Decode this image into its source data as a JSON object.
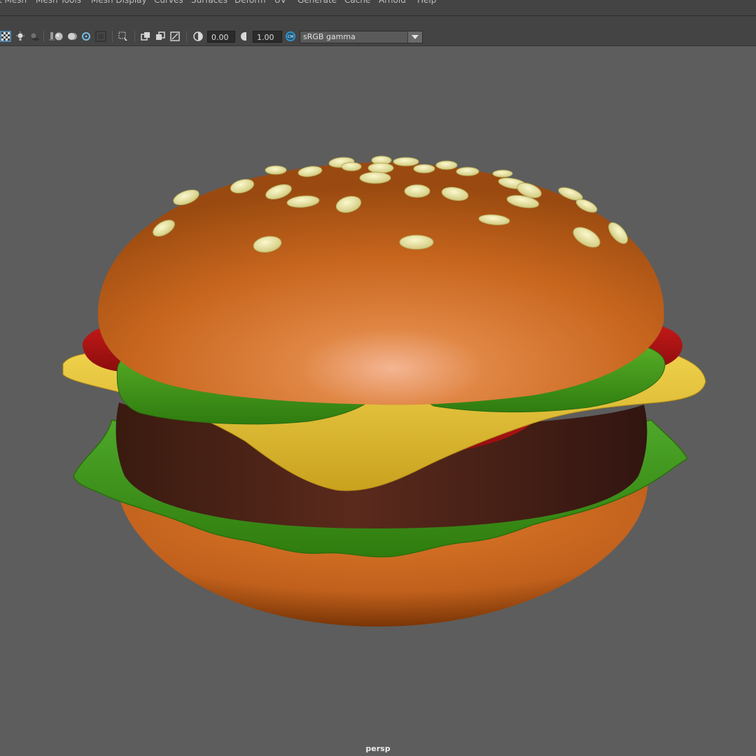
{
  "menubar": {
    "items": [
      "t Mesh",
      "Mesh Tools",
      "Mesh Display",
      "Curves",
      "Surfaces",
      "Deform",
      "UV",
      "Generate",
      "Cache",
      "Arnold",
      "Help"
    ]
  },
  "toolbar": {
    "exposure_value": "0.00",
    "gamma_value": "1.00",
    "color_management_badge": "CM",
    "view_transform": "sRGB gamma",
    "icons": [
      "checker-shading-icon",
      "lighting-icon",
      "shadows-icon",
      "ambient-occlusion-icon",
      "motion-blur-icon",
      "anti-aliasing-icon",
      "depth-of-field-icon",
      "isolate-select-icon",
      "xray-icon",
      "xray-active-components-icon",
      "xray-joints-icon",
      "exposure-icon",
      "gamma-icon",
      "color-management-icon",
      "dropdown-arrow-icon"
    ]
  },
  "viewport": {
    "camera_label": "persp",
    "background": "#5d5d5d",
    "model": "hamburger",
    "colors": {
      "bun": "#c8661e",
      "sesame": "#ece8a0",
      "tomato": "#b31414",
      "cheese": "#e6c23a",
      "pickle": "#4c9a20",
      "patty": "#4a2418",
      "lettuce": "#3f9a18"
    }
  }
}
